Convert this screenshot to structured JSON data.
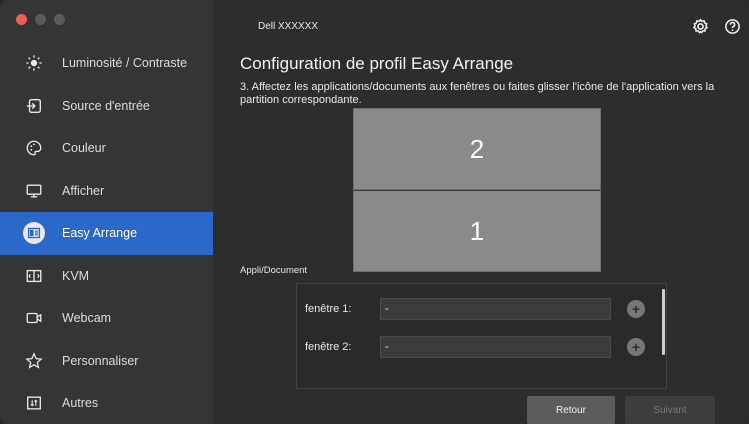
{
  "window": {
    "app_title": "Dell XXXXXX"
  },
  "sidebar": {
    "items": [
      {
        "label": "Luminosité / Contraste",
        "icon": "brightness-icon"
      },
      {
        "label": "Source d'entrée",
        "icon": "input-source-icon"
      },
      {
        "label": "Couleur",
        "icon": "color-palette-icon"
      },
      {
        "label": "Afficher",
        "icon": "display-monitor-icon"
      },
      {
        "label": "Easy Arrange",
        "icon": "easy-arrange-icon",
        "active": true
      },
      {
        "label": "KVM",
        "icon": "kvm-icon"
      },
      {
        "label": "Webcam",
        "icon": "webcam-icon"
      },
      {
        "label": "Personnaliser",
        "icon": "star-icon"
      },
      {
        "label": "Autres",
        "icon": "others-icon"
      }
    ]
  },
  "main": {
    "title": "Configuration de profil Easy Arrange",
    "instruction": "3. Affectez les applications/documents aux fenêtres ou faites glisser l'icône de l'application vers la partition correspondante.",
    "partitions": [
      {
        "label": "2"
      },
      {
        "label": "1"
      }
    ],
    "section_label": "Appli/Document",
    "assignments": [
      {
        "label": "fenêtre 1:",
        "value": "-"
      },
      {
        "label": "fenêtre 2:",
        "value": "-"
      }
    ],
    "add_symbol": "+",
    "buttons": {
      "back": "Retour",
      "next": "Suivant"
    }
  },
  "colors": {
    "accent": "#2b68c8",
    "background": "#2d2d2d",
    "sidebar": "#353535",
    "partition": "#8a8a8a"
  }
}
